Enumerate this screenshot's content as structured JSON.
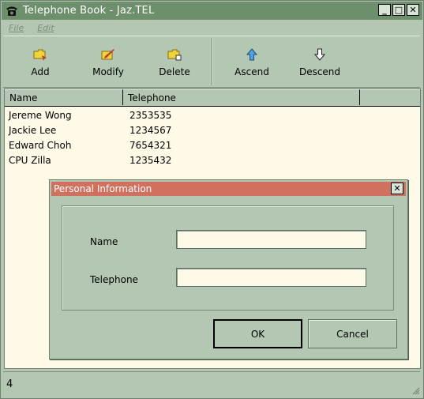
{
  "window": {
    "title": "Telephone Book - Jaz.TEL",
    "icon": "telephone-icon"
  },
  "window_buttons": {
    "minimize": "_",
    "maximize": "□",
    "close": "✕"
  },
  "menu": [
    {
      "label": "File"
    },
    {
      "label": "Edit"
    }
  ],
  "toolbar": [
    {
      "label": "Add",
      "icon": "folder-add-icon"
    },
    {
      "label": "Modify",
      "icon": "edit-icon"
    },
    {
      "label": "Delete",
      "icon": "folder-delete-icon"
    },
    {
      "label": "Ascend",
      "icon": "arrow-up-icon"
    },
    {
      "label": "Descend",
      "icon": "arrow-down-icon"
    }
  ],
  "table": {
    "columns": [
      "Name",
      "Telephone",
      ""
    ],
    "rows": [
      {
        "name": "Jereme Wong",
        "telephone": "2353535"
      },
      {
        "name": "Jackie Lee",
        "telephone": "1234567"
      },
      {
        "name": "Edward Choh",
        "telephone": "7654321"
      },
      {
        "name": "CPU Zilla",
        "telephone": "1235432"
      }
    ]
  },
  "status": {
    "count": "4"
  },
  "dialog": {
    "title": "Personal Information",
    "close": "✕",
    "fields": [
      {
        "label": "Name",
        "value": ""
      },
      {
        "label": "Telephone",
        "value": ""
      }
    ],
    "ok_label": "OK",
    "cancel_label": "Cancel"
  },
  "colors": {
    "accent": "#6d8f6b",
    "dialog_title": "#d0715f",
    "background": "#b3c7b2",
    "field": "#fff9e8"
  }
}
